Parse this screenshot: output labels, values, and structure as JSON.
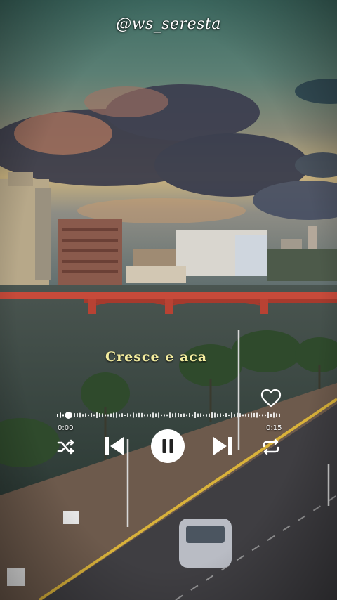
{
  "watermark": "@ws_seresta",
  "lyric": "Cresce e aca",
  "player": {
    "time_elapsed": "0:00",
    "time_total": "0:15",
    "progress": 0.03,
    "liked": false
  },
  "icons": {
    "like": "heart-icon",
    "shuffle": "shuffle-icon",
    "previous": "skip-previous-icon",
    "play_pause": "pause-icon",
    "next": "skip-next-icon",
    "repeat": "repeat-icon"
  },
  "colors": {
    "lyric": "#f3ec9e",
    "controls": "#ffffff"
  }
}
